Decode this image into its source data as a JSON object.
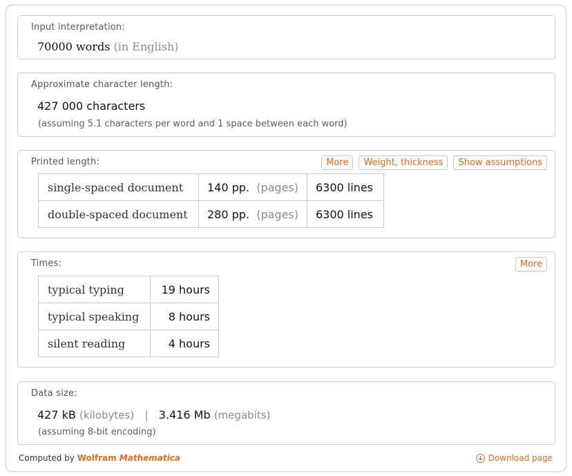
{
  "pods": {
    "input": {
      "title": "Input interpretation:",
      "value": "70000 words",
      "qualifier": "(in English)"
    },
    "char_length": {
      "title": "Approximate character length:",
      "value": "427 000 characters",
      "note": "(assuming 5.1 characters per word and 1 space between each word)"
    },
    "printed": {
      "title": "Printed length:",
      "buttons": [
        "More",
        "Weight, thickness",
        "Show assumptions"
      ],
      "rows": [
        {
          "label": "single-spaced document",
          "pages": "140 pp.",
          "pages_unit": "(pages)",
          "lines": "6300 lines"
        },
        {
          "label": "double-spaced document",
          "pages": "280 pp.",
          "pages_unit": "(pages)",
          "lines": "6300 lines"
        }
      ]
    },
    "times": {
      "title": "Times:",
      "button": "More",
      "rows": [
        {
          "label": "typical typing",
          "value": "19 hours"
        },
        {
          "label": "typical speaking",
          "value": "8 hours"
        },
        {
          "label": "silent reading",
          "value": "4 hours"
        }
      ]
    },
    "data_size": {
      "title": "Data size:",
      "kb_value": "427 kB",
      "kb_unit": "(kilobytes)",
      "separator": "|",
      "mb_value": "3.416 Mb",
      "mb_unit": "(megabits)",
      "note": "(assuming 8-bit encoding)"
    }
  },
  "footer": {
    "computed_by": "Computed by",
    "brand_wolfram": "Wolfram",
    "brand_mathematica": "Mathematica",
    "download": "Download page",
    "download_icon": "download-circle-icon"
  },
  "colors": {
    "accent": "#e96a17",
    "title": "#5b4f6d",
    "border": "#cbcbcb"
  }
}
